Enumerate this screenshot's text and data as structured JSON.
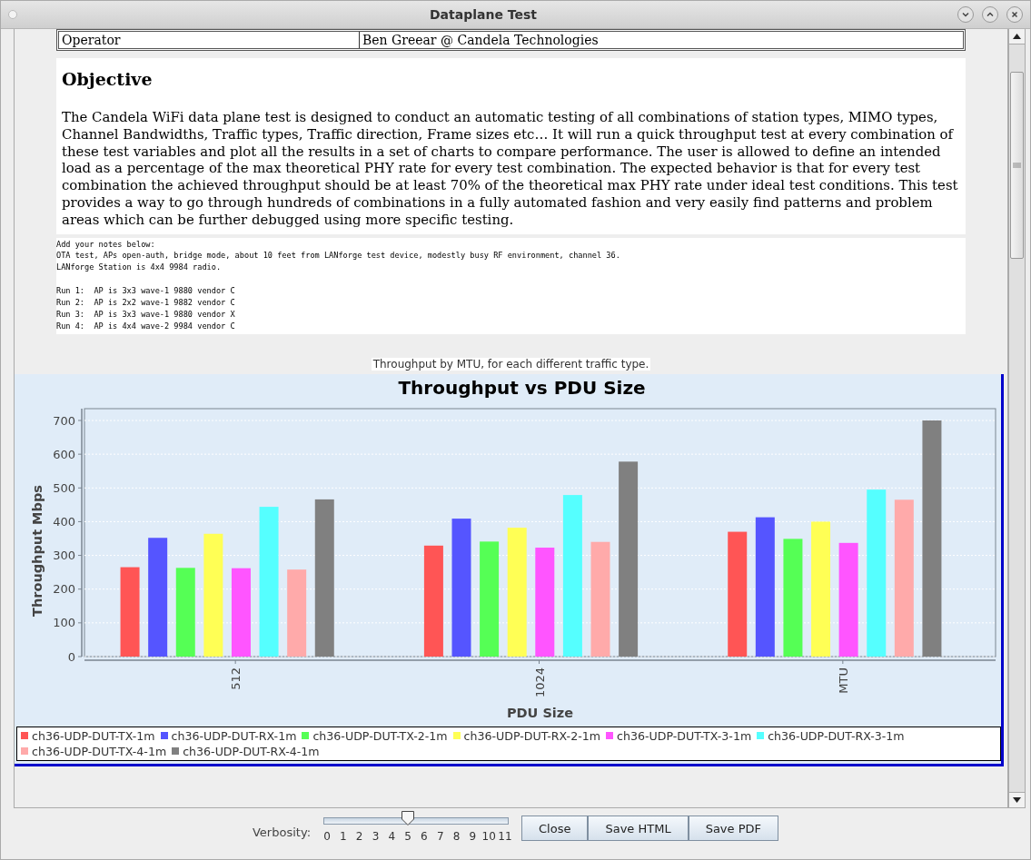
{
  "window": {
    "title": "Dataplane Test"
  },
  "info_table": {
    "rows": [
      {
        "label": "Operator",
        "value": "Ben Greear @ Candela Technologies"
      }
    ]
  },
  "objective": {
    "heading": "Objective",
    "text": "The Candela WiFi data plane test is designed to conduct an automatic testing of all combinations of station types, MIMO types, Channel Bandwidths, Traffic types, Traffic direction, Frame sizes etc… It will run a quick throughput test at every combination of these test variables and plot all the results in a set of charts to compare performance. The user is allowed to define an intended load as a percentage of the max theoretical PHY rate for every test combination. The expected behavior is that for every test combination the achieved throughput should be at least 70% of the theoretical max PHY rate under ideal test conditions. This test provides a way to go through hundreds of combinations in a fully automated fashion and very easily find patterns and problem areas which can be further debugged using more specific testing."
  },
  "notes": {
    "value": "Add your notes below:\nOTA test, APs open-auth, bridge mode, about 10 feet from LANforge test device, modestly busy RF environment, channel 36.\nLANforge Station is 4x4 9984 radio.\n\nRun 1:  AP is 3x3 wave-1 9880 vendor C\nRun 2:  AP is 2x2 wave-1 9882 vendor C\nRun 3:  AP is 3x3 wave-1 9880 vendor X\nRun 4:  AP is 4x4 wave-2 9984 vendor C"
  },
  "chart": {
    "caption": "Throughput by MTU, for each different traffic type.",
    "chart_data": {
      "type": "bar",
      "title": "Throughput vs PDU Size",
      "xlabel": "PDU Size",
      "ylabel": "Throughput Mbps",
      "categories": [
        "512",
        "1024",
        "MTU"
      ],
      "ylim": [
        0,
        700
      ],
      "grid": true,
      "yticks": [
        0,
        100,
        200,
        300,
        400,
        500,
        600,
        700
      ],
      "series": [
        {
          "name": "ch36-UDP-DUT-TX-1m",
          "color": "#ff5555",
          "values": [
            265,
            329,
            370
          ]
        },
        {
          "name": "ch36-UDP-DUT-RX-1m",
          "color": "#5555ff",
          "values": [
            352,
            409,
            413
          ]
        },
        {
          "name": "ch36-UDP-DUT-TX-2-1m",
          "color": "#55ff55",
          "values": [
            263,
            341,
            349
          ]
        },
        {
          "name": "ch36-UDP-DUT-RX-2-1m",
          "color": "#ffff55",
          "values": [
            364,
            382,
            400
          ]
        },
        {
          "name": "ch36-UDP-DUT-TX-3-1m",
          "color": "#ff55ff",
          "values": [
            262,
            323,
            337
          ]
        },
        {
          "name": "ch36-UDP-DUT-RX-3-1m",
          "color": "#55ffff",
          "values": [
            444,
            479,
            495
          ]
        },
        {
          "name": "ch36-UDP-DUT-TX-4-1m",
          "color": "#ffaaaa",
          "values": [
            258,
            340,
            465
          ]
        },
        {
          "name": "ch36-UDP-DUT-RX-4-1m",
          "color": "#808080",
          "values": [
            466,
            578,
            700
          ]
        }
      ]
    }
  },
  "footer": {
    "verbosity": {
      "label": "Verbosity:",
      "level": 0.4545,
      "ticks": [
        "0",
        "1",
        "2",
        "3",
        "4",
        "5",
        "6",
        "7",
        "8",
        "9",
        "10",
        "11"
      ]
    },
    "buttons": [
      "Close",
      "Save HTML",
      "Save PDF"
    ]
  }
}
